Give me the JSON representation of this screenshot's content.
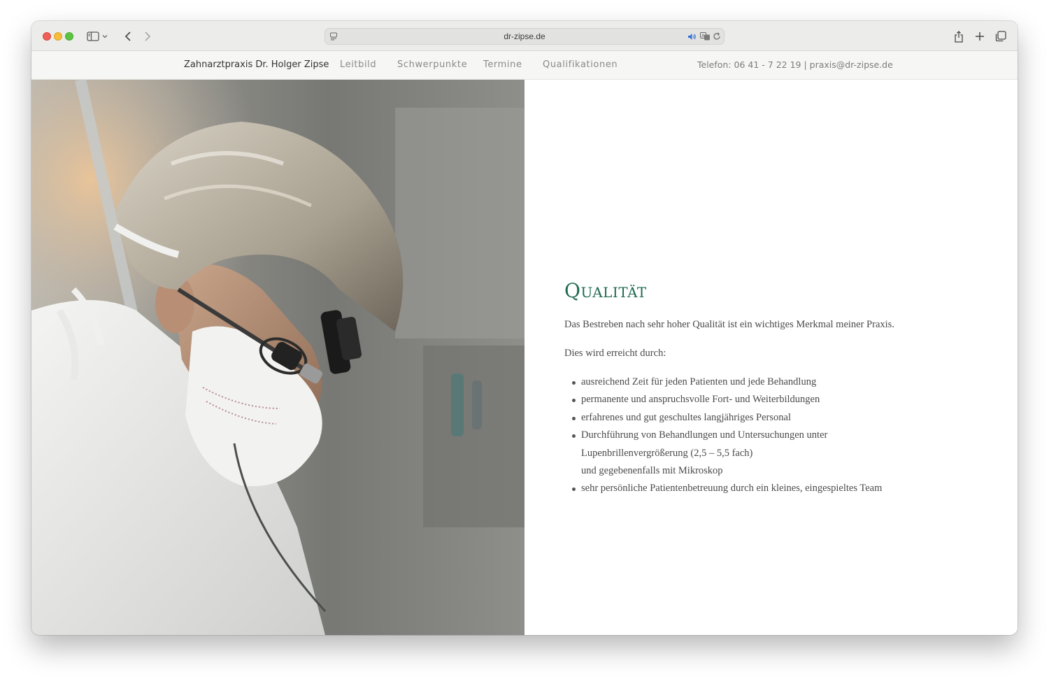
{
  "browser": {
    "url": "dr-zipse.de"
  },
  "site_nav": {
    "brand": "Zahnarztpraxis Dr. Holger Zipse",
    "links": [
      "Leitbild",
      "Schwerpunkte",
      "Termine",
      "Qualifikationen"
    ],
    "contact": "Telefon: 06 41 - 7 22 19 | praxis@dr-zipse.de"
  },
  "content": {
    "heading": "Qualität",
    "intro": "Das Bestreben nach sehr hoher Qualität ist ein wichtiges Merkmal meiner Praxis.",
    "lead": "Dies wird erreicht durch:",
    "bullets": [
      [
        "ausreichend Zeit für jeden Patienten und jede Behandlung"
      ],
      [
        "permanente und anspruchsvolle Fort- und Weiterbildungen"
      ],
      [
        "erfahrenes und gut geschultes langjähriges Personal"
      ],
      [
        "Durchführung von Behandlungen und Untersuchungen unter",
        "Lupenbrillenvergrößerung (2,5 – 5,5 fach)",
        "und gegebenenfalls mit Mikroskop"
      ],
      [
        "sehr persönliche Patientenbetreuung durch ein kleines, eingespieltes Team"
      ]
    ]
  },
  "colors": {
    "accent": "#1f6b52",
    "nav_bg": "#f6f6f4",
    "toolbar_bg": "#ececeb"
  },
  "icons": [
    "sidebar-icon",
    "chevron-down-icon",
    "back-icon",
    "forward-icon",
    "page-settings-icon",
    "speaker-icon",
    "translate-icon",
    "reload-icon",
    "share-icon",
    "new-tab-icon",
    "tab-overview-icon"
  ]
}
